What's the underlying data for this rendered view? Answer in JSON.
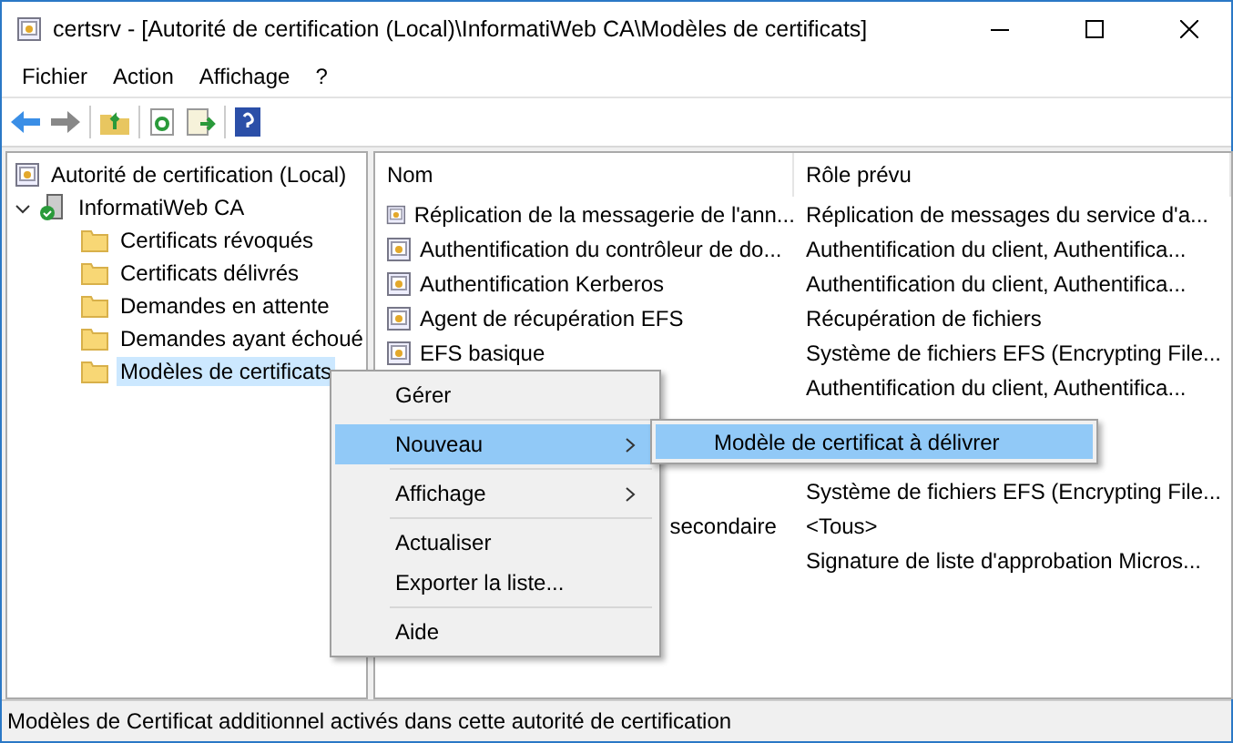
{
  "window": {
    "title": "certsrv - [Autorité de certification (Local)\\InformatiWeb CA\\Modèles de certificats]"
  },
  "menu_bar": [
    "Fichier",
    "Action",
    "Affichage",
    "?"
  ],
  "tree": {
    "label": "Autorité de certification (Local)",
    "children": [
      {
        "label": "InformatiWeb CA",
        "expanded": true,
        "children": [
          {
            "label": "Certificats révoqués",
            "selected": false
          },
          {
            "label": "Certificats délivrés",
            "selected": false
          },
          {
            "label": "Demandes en attente",
            "selected": false
          },
          {
            "label": "Demandes ayant échoué",
            "selected": false
          },
          {
            "label": "Modèles de certificats",
            "selected": true
          }
        ]
      }
    ]
  },
  "table": {
    "columns": [
      "Nom",
      "Rôle prévu"
    ],
    "rows": [
      {
        "name": "Réplication de la messagerie de l'ann...",
        "role": "Réplication de messages du service d'a..."
      },
      {
        "name": "Authentification du contrôleur de do...",
        "role": "Authentification du client, Authentifica..."
      },
      {
        "name": "Authentification Kerberos",
        "role": "Authentification du client, Authentifica..."
      },
      {
        "name": "Agent de récupération EFS",
        "role": "Récupération de fichiers"
      },
      {
        "name": "EFS basique",
        "role": "Système de fichiers EFS (Encrypting File..."
      },
      {
        "role": "Authentification du client, Authentifica..."
      },
      {},
      {},
      {
        "role": "Système de fichiers EFS (Encrypting File..."
      },
      {
        "name": "secondaire",
        "role": "<Tous>",
        "kind": "covered"
      },
      {
        "role": "Signature de liste d'approbation Micros..."
      }
    ]
  },
  "context_menu": {
    "items": [
      {
        "label": "Gérer",
        "submenu": false,
        "selected": false,
        "separator_before": false
      },
      {
        "label": "Nouveau",
        "submenu": true,
        "selected": true,
        "separator_before": true
      },
      {
        "label": "Affichage",
        "submenu": true,
        "selected": false,
        "separator_before": true
      },
      {
        "label": "Actualiser",
        "submenu": false,
        "selected": false,
        "separator_before": true
      },
      {
        "label": "Exporter la liste...",
        "submenu": false,
        "selected": false,
        "separator_before": false
      },
      {
        "label": "Aide",
        "submenu": false,
        "selected": false,
        "separator_before": true
      }
    ]
  },
  "submenu": {
    "items": [
      {
        "label": "Modèle de certificat à délivrer",
        "selected": true
      }
    ]
  },
  "status_bar": "Modèles de Certificat additionnel activés dans cette autorité de certification"
}
